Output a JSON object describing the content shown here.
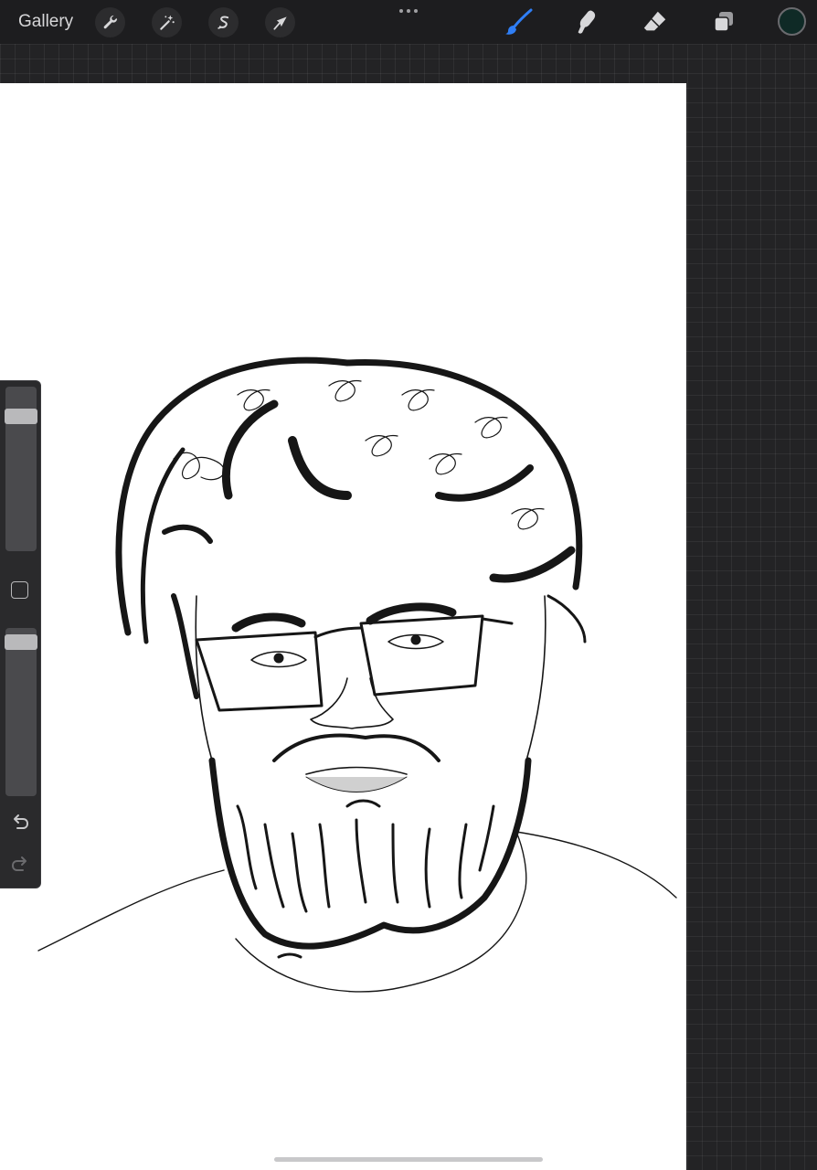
{
  "toolbar": {
    "gallery_label": "Gallery",
    "left_tools": [
      "wrench-icon",
      "magic-wand-icon",
      "selection-icon",
      "transform-arrow-icon"
    ],
    "right_tools": [
      "brush-icon",
      "smudge-icon",
      "eraser-icon",
      "layers-icon"
    ],
    "active_tool": "brush",
    "active_color": "#0f2a26",
    "accent_color": "#2f7ef5"
  },
  "sidebar": {
    "brush_size_level": 0.85,
    "opacity_level": 0.96
  }
}
